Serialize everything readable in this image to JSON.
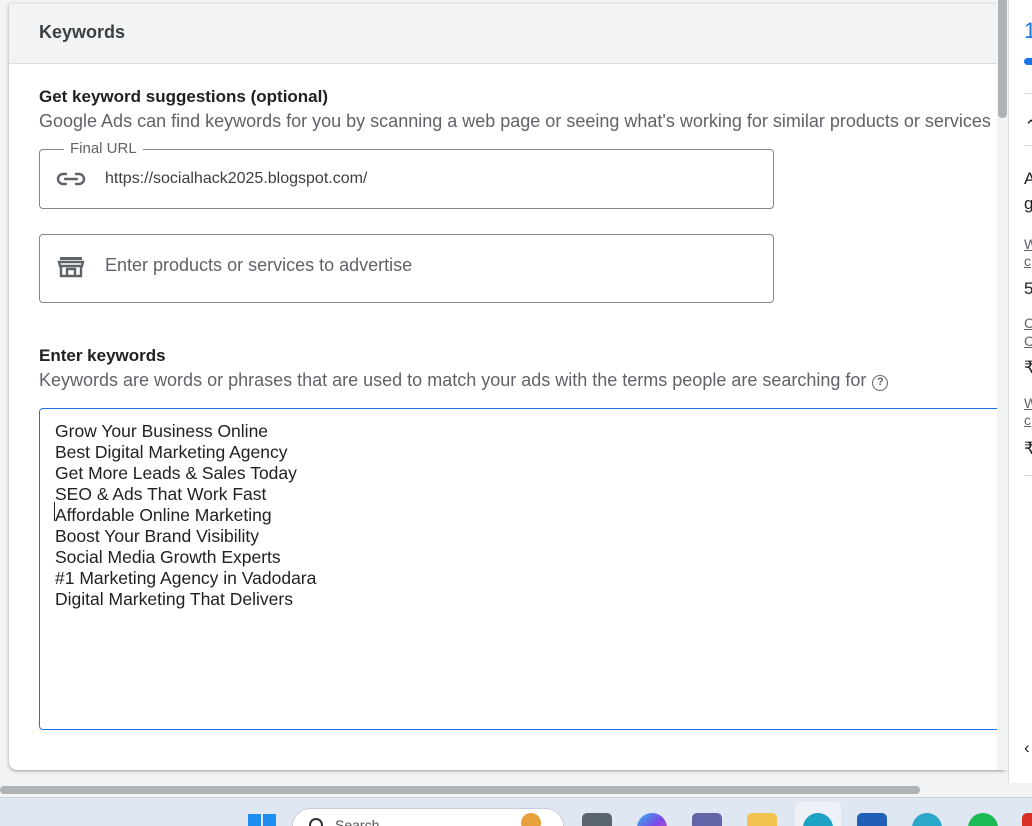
{
  "card": {
    "title": "Keywords"
  },
  "suggestions": {
    "title": "Get keyword suggestions (optional)",
    "description": "Google Ads can find keywords for you by scanning a web page or seeing what's working for similar products or services",
    "url_field": {
      "label": "Final URL",
      "value": "https://socialhack2025.blogspot.com/",
      "icon": "link-icon"
    },
    "products_field": {
      "placeholder": "Enter products or services to advertise",
      "icon": "storefront-icon"
    }
  },
  "keywords": {
    "title": "Enter keywords",
    "description": "Keywords are words or phrases that are used to match your ads with the terms people are searching for",
    "help_icon": "?",
    "lines": [
      "Grow Your Business Online",
      "Best Digital Marketing Agency",
      "Get More Leads & Sales Today",
      "SEO & Ads That Work Fast",
      "Affordable Online Marketing",
      "Boost Your Brand Visibility",
      "Social Media Growth Experts",
      "#1 Marketing Agency in Vadodara",
      "Digital Marketing That Delivers"
    ]
  },
  "side_panel": {
    "number": "1",
    "texts": [
      "A",
      "g",
      "5",
      "₹",
      "₹"
    ],
    "links": [
      "W",
      "c",
      "C",
      "C",
      "W",
      "c"
    ]
  },
  "taskbar": {
    "search_text": "Search"
  },
  "colors": {
    "accent": "#1a73e8",
    "header_bg": "#f1f3f4",
    "text_primary": "#202124",
    "text_secondary": "#5f6368"
  }
}
